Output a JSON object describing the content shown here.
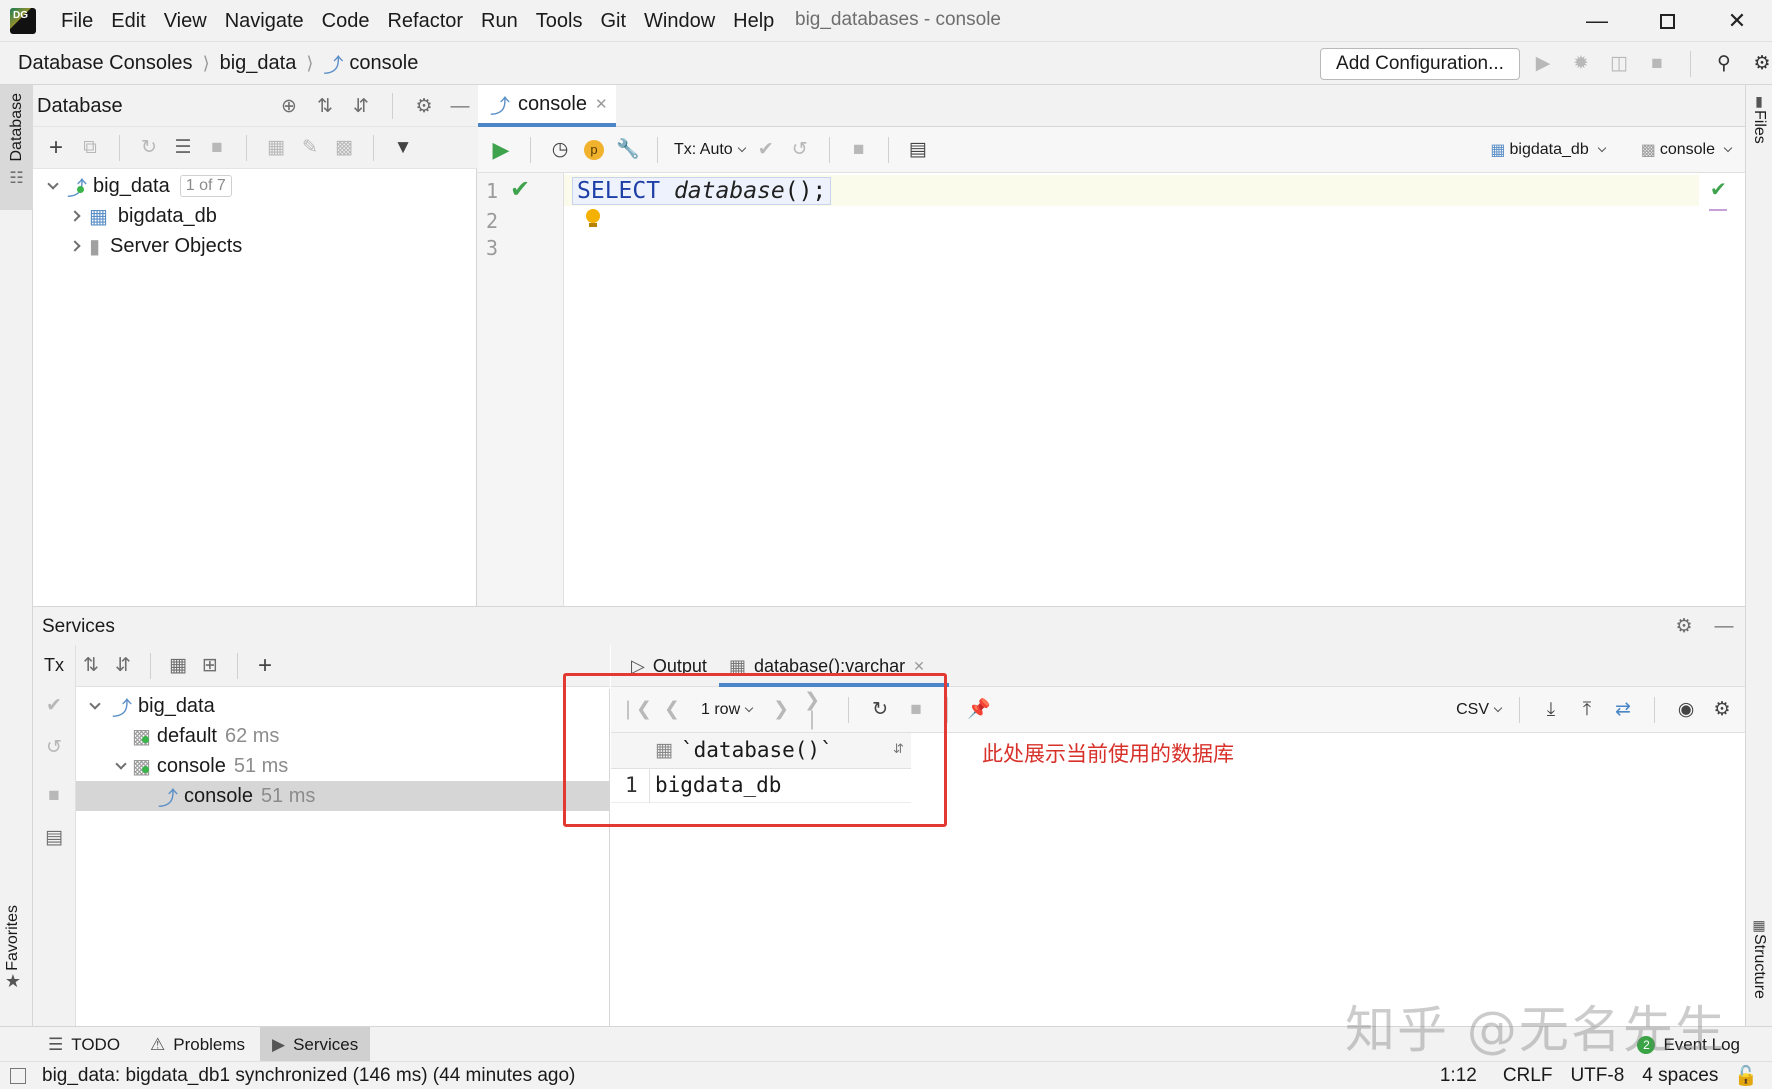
{
  "menu": {
    "items": [
      "File",
      "Edit",
      "View",
      "Navigate",
      "Code",
      "Refactor",
      "Run",
      "Tools",
      "Git",
      "Window",
      "Help"
    ],
    "window_title": "big_databases - console"
  },
  "navbar": {
    "breadcrumb": [
      "Database Consoles",
      "big_data",
      "console"
    ],
    "add_configuration": "Add Configuration..."
  },
  "left_stripe": {
    "database": "Database",
    "favorites": "Favorites"
  },
  "right_stripe": {
    "files": "Files",
    "structure": "Structure"
  },
  "database_panel": {
    "title": "Database",
    "tree": {
      "root": {
        "label": "big_data",
        "badge": "1 of 7"
      },
      "children": [
        {
          "label": "bigdata_db"
        },
        {
          "label": "Server Objects"
        }
      ]
    }
  },
  "editor": {
    "tab_label": "console",
    "tx_mode": "Tx: Auto",
    "schema": "bigdata_db",
    "session": "console",
    "line_numbers": [
      "1",
      "2",
      "3"
    ],
    "code": {
      "keyword": "SELECT",
      "func": "database",
      "rest": "();"
    }
  },
  "services": {
    "title": "Services",
    "tx_label": "Tx",
    "tree": [
      {
        "label": "big_data",
        "time": ""
      },
      {
        "label": "default",
        "time": "62 ms"
      },
      {
        "label": "console",
        "time": "51 ms"
      },
      {
        "label": "console",
        "time": "51 ms"
      }
    ],
    "output_tabs": [
      "Output",
      "database():varchar"
    ],
    "rows_label": "1 row",
    "export_format": "CSV",
    "result": {
      "column": "`database()`",
      "rows": [
        {
          "n": "1",
          "value": "bigdata_db"
        }
      ]
    },
    "annotation": "此处展示当前使用的数据库"
  },
  "toolwindows": {
    "todo": "TODO",
    "problems": "Problems",
    "services": "Services",
    "event_log": "Event Log",
    "event_count": "2"
  },
  "status": {
    "message": "big_data: bigdata_db1 synchronized (146 ms) (44 minutes ago)",
    "position": "1:12",
    "line_sep": "CRLF",
    "encoding": "UTF-8",
    "indent": "4 spaces"
  },
  "watermark": "知乎 @无名先生",
  "colors": {
    "accent": "#4a86c8",
    "annotation": "#d7312a",
    "run": "#3fa34d"
  }
}
